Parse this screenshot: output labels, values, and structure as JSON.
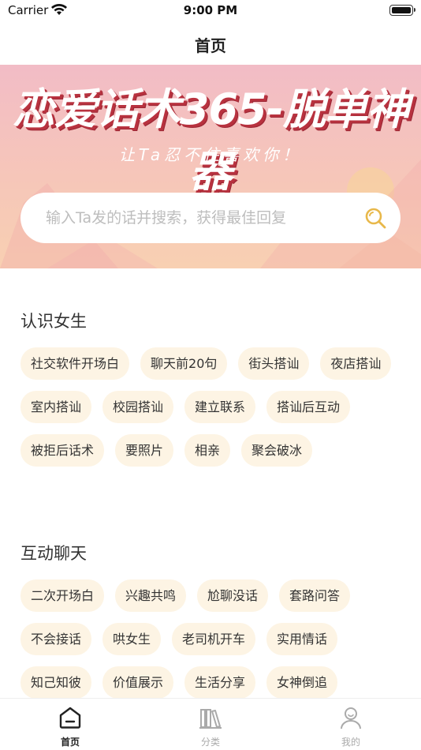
{
  "status_bar": {
    "carrier": "Carrier",
    "time": "9:00 PM"
  },
  "nav": {
    "title": "首页"
  },
  "banner": {
    "headline": "恋爱话术365-脱单神器",
    "subline": "让Ta忍不住喜欢你！",
    "search_placeholder": "输入Ta发的话并搜索，获得最佳回复"
  },
  "sections": [
    {
      "title": "认识女生",
      "tags": [
        "社交软件开场白",
        "聊天前20句",
        "街头搭讪",
        "夜店搭讪",
        "室内搭讪",
        "校园搭讪",
        "建立联系",
        "搭讪后互动",
        "被拒后话术",
        "要照片",
        "相亲",
        "聚会破冰"
      ]
    },
    {
      "title": "互动聊天",
      "tags": [
        "二次开场白",
        "兴趣共鸣",
        "尬聊没话",
        "套路问答",
        "不会接话",
        "哄女生",
        "老司机开车",
        "实用情话",
        "知己知彼",
        "价值展示",
        "生活分享",
        "女神倒追"
      ]
    }
  ],
  "tab_bar": {
    "items": [
      {
        "label": "首页",
        "icon": "home-icon",
        "active": true
      },
      {
        "label": "分类",
        "icon": "books-icon",
        "active": false
      },
      {
        "label": "我的",
        "icon": "person-icon",
        "active": false
      }
    ]
  },
  "colors": {
    "tag_bg": "#fdf4e4",
    "search_icon": "#e8b84a",
    "banner_top": "#f2bcc6",
    "banner_bottom": "#f8d0b2"
  }
}
